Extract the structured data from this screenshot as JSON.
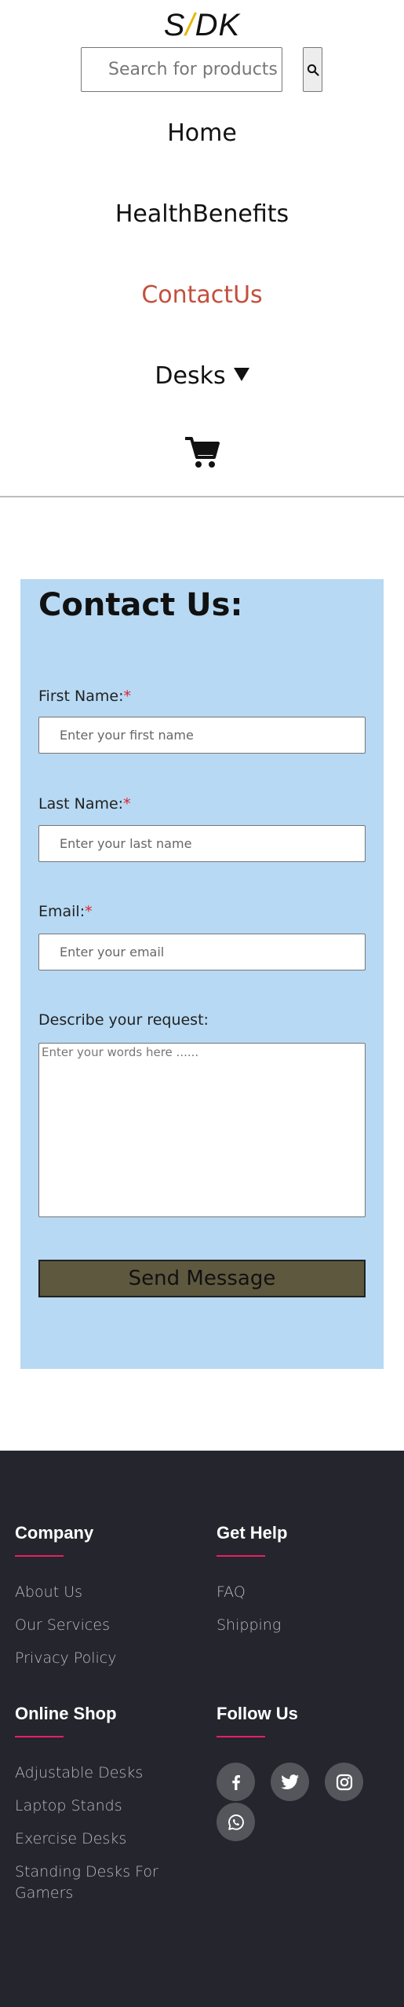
{
  "header": {
    "logo": {
      "left": "S",
      "slash": "/",
      "right": "DK"
    },
    "search": {
      "placeholder": "Search for products"
    },
    "nav": {
      "home": "Home",
      "health_benefits": "HealthBenefits",
      "contact_us": "ContactUs",
      "desks": "Desks"
    },
    "active_color": "#c2503c"
  },
  "contact_form": {
    "title": "Contact Us:",
    "required_mark": "*",
    "first_name": {
      "label": "First Name:",
      "placeholder": "Enter your first name"
    },
    "last_name": {
      "label": "Last Name:",
      "placeholder": "Enter your last name"
    },
    "email": {
      "label": "Email:",
      "placeholder": "Enter your email"
    },
    "request": {
      "label": "Describe your request:",
      "placeholder": "Enter your words here ......"
    },
    "submit_label": "Send Message",
    "background": "#b7d9f3"
  },
  "footer": {
    "company": {
      "heading": "Company",
      "links": [
        "About Us",
        "Our Services",
        "Privacy Policy"
      ]
    },
    "get_help": {
      "heading": "Get Help",
      "links": [
        "FAQ",
        "Shipping"
      ]
    },
    "online_shop": {
      "heading": "Online Shop",
      "links": [
        "Adjustable Desks",
        "Laptop Stands",
        "Exercise Desks",
        "Standing Desks For Gamers"
      ]
    },
    "follow_us": {
      "heading": "Follow Us",
      "icons": [
        "facebook-icon",
        "twitter-icon",
        "instagram-icon",
        "whatsapp-icon"
      ]
    },
    "accent": "#e91e63",
    "background": "#24252d"
  }
}
